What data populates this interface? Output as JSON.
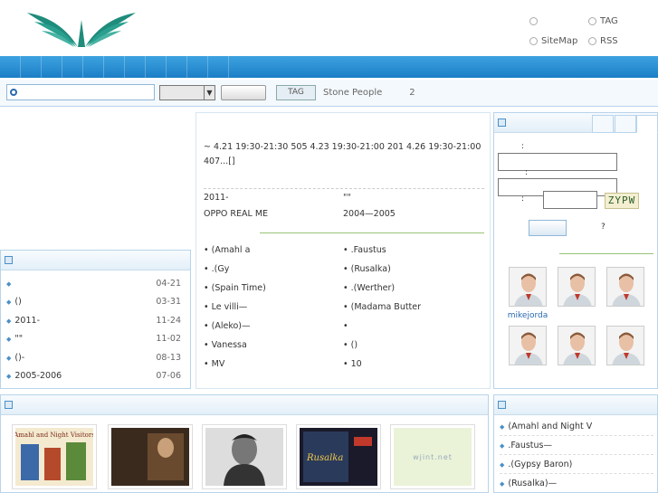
{
  "header": {
    "links": [
      {
        "label": "",
        "icon": "user-icon"
      },
      {
        "label": "TAG",
        "icon": "tag-icon"
      },
      {
        "label": "SiteMap",
        "icon": "sitemap-icon"
      },
      {
        "label": "RSS",
        "icon": "rss-icon"
      }
    ]
  },
  "nav": {
    "items": [
      "",
      "",
      "",
      "",
      "",
      "",
      "",
      "",
      "",
      "",
      ""
    ]
  },
  "search": {
    "placeholder": "",
    "select_value": "",
    "button_label": "",
    "hot_tag_label": "TAG",
    "hot_links": [
      "Stone People",
      "",
      "",
      "",
      "",
      "2",
      "",
      ""
    ]
  },
  "left_list": {
    "title": "",
    "items": [
      {
        "title": "",
        "date": "04-21"
      },
      {
        "title": "()",
        "date": "03-31"
      },
      {
        "title": "2011-",
        "date": "11-24"
      },
      {
        "title": "\"\"",
        "date": "11-02"
      },
      {
        "title": "()-",
        "date": "08-13"
      },
      {
        "title": "2005-2006",
        "date": "07-06"
      }
    ]
  },
  "center": {
    "title": "",
    "body": "~  4.21 19:30-21:30  505  4.23 19:30-21:00  201  4.26 19:30-21:00  407...[]",
    "featured": [
      "2011-",
      "\"\"",
      "OPPO REAL ME",
      "2004—2005"
    ],
    "latest_label": "",
    "latest": [
      "(Amahl a",
      ".Faustus",
      ".(Gy",
      "(Rusalka)",
      "(Spain Time)",
      ".(Werther)",
      "Le villi—",
      "(Madama Butter",
      "(Aleko)—",
      "",
      "Vanessa",
      "()",
      " MV ",
      "10"
    ]
  },
  "right_panel": {
    "title": "",
    "tabs": [
      "",
      "",
      ""
    ],
    "username_label": ":",
    "password_label": ":",
    "captcha_label": ":",
    "captcha_text": "ZYPW",
    "login_button": "",
    "register_link": "",
    "forgot_link": "?",
    "members_title": "",
    "members": [
      "mikejorda",
      "",
      "",
      "",
      "",
      ""
    ]
  },
  "bottom_left": {
    "title": "",
    "thumb_placeholder": "",
    "thumb_sub": "wjint.net",
    "thumb_labels": [
      "Amahl and Night Visitors",
      "",
      "",
      "Rusalka"
    ]
  },
  "bottom_right": {
    "title": "",
    "items": [
      "(Amahl and Night V",
      ".Faustus—",
      ".(Gypsy Baron)",
      "(Rusalka)—"
    ]
  },
  "colors": {
    "nav": "#2a8dd4",
    "accent": "#2a6ab0",
    "border": "#b8d4ea"
  }
}
